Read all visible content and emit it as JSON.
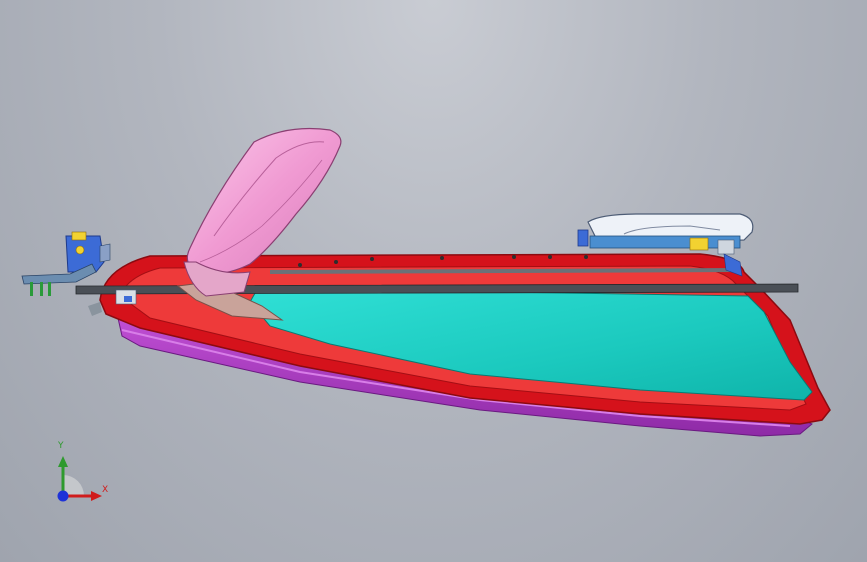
{
  "viewport": {
    "background": "#b2b6bf",
    "parts": [
      {
        "name": "glass-pane",
        "color": "#19d2c6"
      },
      {
        "name": "lower-shroud",
        "color": "#b43cc8"
      },
      {
        "name": "door-frame",
        "color": "#e4141c"
      },
      {
        "name": "door-handle",
        "color": "#eef2f8"
      },
      {
        "name": "mirror-housing",
        "color": "#f3a1d6"
      },
      {
        "name": "hinge-bracket",
        "color": "#3c6bd6"
      },
      {
        "name": "guide-rail",
        "color": "#5a5f66"
      }
    ]
  },
  "triad": {
    "y_label": "Y",
    "x_label": "X",
    "y_color": "#2e9a2e",
    "x_color": "#d01c1c",
    "z_color": "#1e32d8"
  }
}
